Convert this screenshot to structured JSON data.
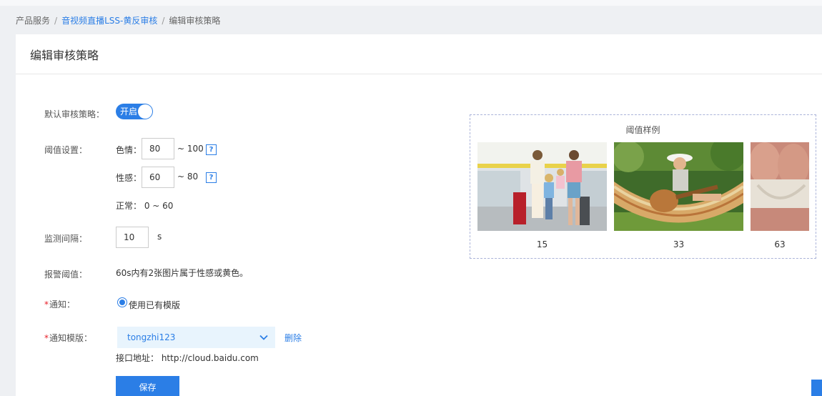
{
  "breadcrumb": {
    "root": "产品服务",
    "parent": "音视频直播LSS-黄反审核",
    "current": "编辑审核策略",
    "separator": "/"
  },
  "page": {
    "title": "编辑审核策略"
  },
  "form": {
    "default_policy": {
      "label": "默认审核策略：",
      "toggle_label": "开启",
      "enabled": true
    },
    "threshold": {
      "label": "阈值设置：",
      "porn": {
        "label": "色情：",
        "value": "80",
        "range": "~ 100"
      },
      "sexy": {
        "label": "性感：",
        "value": "60",
        "range": "~ 80"
      },
      "normal": "正常： 0 ~ 60",
      "help_glyph": "?"
    },
    "interval": {
      "label": "监测间隔：",
      "value": "10",
      "unit": "s"
    },
    "alarm": {
      "label": "报警阈值：",
      "text": "60s内有2张图片属于性感或黄色。"
    },
    "notify": {
      "required_mark": "*",
      "label": "通知：",
      "option": "使用已有模版"
    },
    "template": {
      "required_mark": "*",
      "label": "通知模版：",
      "selected": "tongzhi123",
      "delete_label": "删除",
      "endpoint": "接口地址：  http://cloud.baidu.com"
    },
    "save_label": "保存"
  },
  "samples": {
    "title": "阈值样例",
    "items": [
      {
        "value": "15",
        "icon": "family-airport-photo"
      },
      {
        "value": "33",
        "icon": "guitar-hammock-photo"
      },
      {
        "value": "63",
        "icon": "closeup-photo"
      }
    ]
  },
  "colors": {
    "accent": "#2b7ee6",
    "required": "#e8202a",
    "select_bg": "#e8f4fd"
  }
}
